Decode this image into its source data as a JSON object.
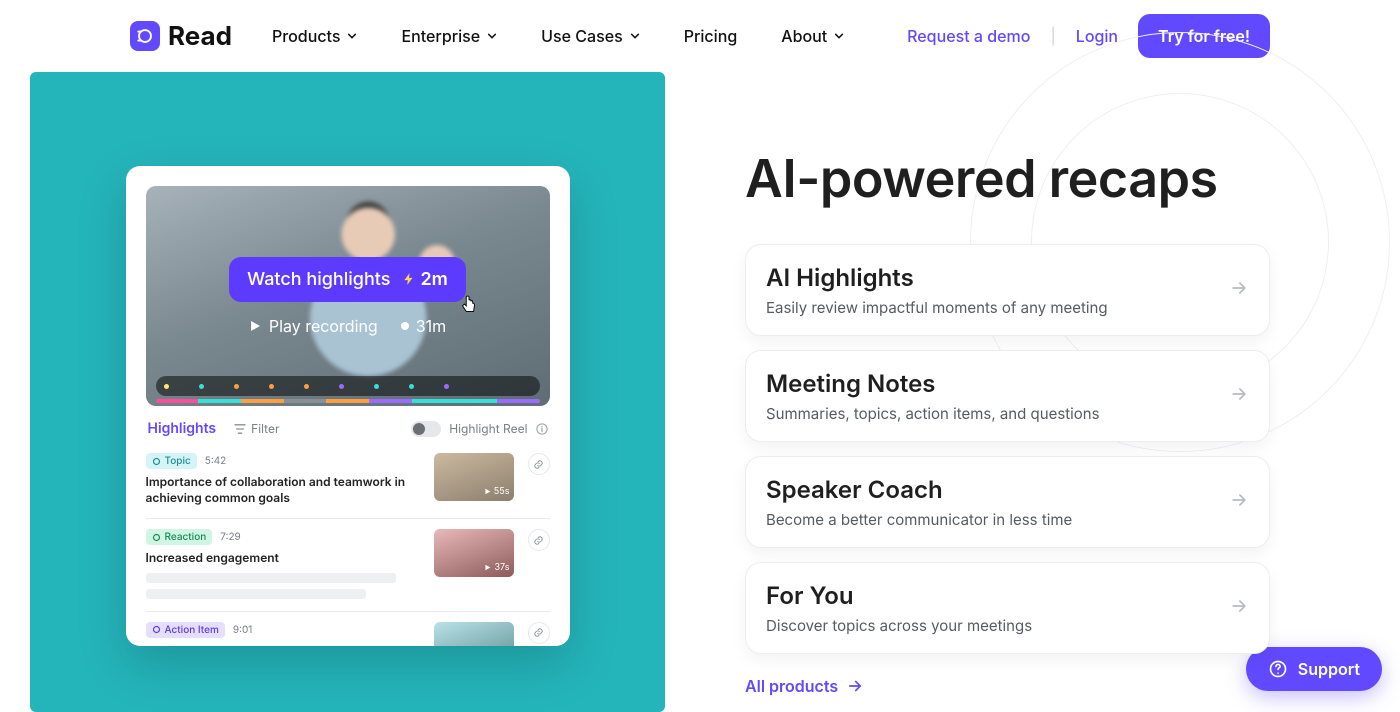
{
  "brand": {
    "name": "Read"
  },
  "nav": {
    "items": [
      {
        "label": "Products",
        "caret": true
      },
      {
        "label": "Enterprise",
        "caret": true
      },
      {
        "label": "Use Cases",
        "caret": true
      },
      {
        "label": "Pricing",
        "caret": false
      },
      {
        "label": "About",
        "caret": true
      }
    ],
    "request_demo": "Request a demo",
    "login": "Login",
    "cta": "Try for free!"
  },
  "hero": {
    "headline": "AI-powered recaps",
    "cards": [
      {
        "title": "AI Highlights",
        "desc": "Easily review impactful moments of any meeting"
      },
      {
        "title": "Meeting Notes",
        "desc": "Summaries, topics, action items, and questions"
      },
      {
        "title": "Speaker Coach",
        "desc": "Become a better communicator in less time"
      },
      {
        "title": "For You",
        "desc": "Discover topics across your meetings"
      }
    ],
    "all_products": "All products"
  },
  "player": {
    "watch_highlights": "Watch highlights",
    "highlights_time": "2m",
    "play_recording": "Play recording",
    "recording_time": "31m",
    "timeline": {
      "dot_colors": [
        "#FFE86B",
        "#35E1D6",
        "#FF9E3D",
        "#FF9E3D",
        "#FF9E3D",
        "#9B6BFF",
        "#35E1D6",
        "#35E1D6",
        "#9B6BFF"
      ],
      "seg_colors": [
        "#FF4D9B",
        "#35E1D6",
        "#FF9E3D",
        "#8A8F94",
        "#FF9E3D",
        "#9B6BFF",
        "#35E1D6",
        "#35E1D6",
        "#9B6BFF"
      ]
    },
    "highlights": {
      "title": "Highlights",
      "filter": "Filter",
      "highlight_reel": "Highlight Reel",
      "items": [
        {
          "tag": "Topic",
          "tag_class": "tag-topic",
          "time": "5:42",
          "text": "Importance of collaboration and teamwork in achieving common goals",
          "dur": "55s"
        },
        {
          "tag": "Reaction",
          "tag_class": "tag-reaction",
          "time": "7:29",
          "text": "Increased engagement",
          "dur": "37s",
          "skeleton": true
        },
        {
          "tag": "Action Item",
          "tag_class": "tag-action",
          "time": "9:01",
          "text": "",
          "dur": ""
        }
      ]
    }
  },
  "support": {
    "label": "Support"
  }
}
